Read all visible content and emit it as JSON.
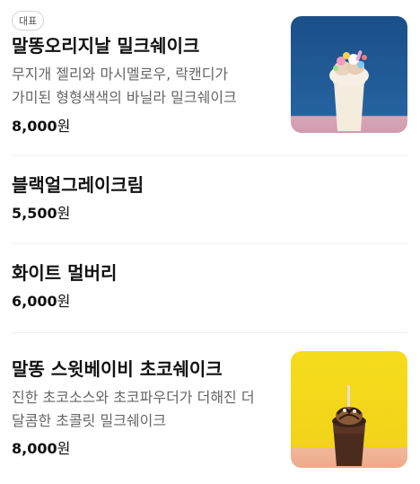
{
  "menu": {
    "items": [
      {
        "badge": "대표",
        "name": "말똥오리지날 밀크쉐이크",
        "description": "무지개 젤리와 마시멜로우, 락캔디가 가미된 형형색색의 바닐라 밀크쉐이크",
        "price": "8,000",
        "currency": "원",
        "image_icon": "milkshake-photo"
      },
      {
        "name": "블랙얼그레이크림",
        "price": "5,500",
        "currency": "원"
      },
      {
        "name": "화이트 멀버리",
        "price": "6,000",
        "currency": "원"
      },
      {
        "name": "말똥 스윗베이비 초코쉐이크",
        "description": "진한 초코소스와 초코파우더가 더해진 더 달콤한 초콜릿 밀크쉐이크",
        "price": "8,000",
        "currency": "원",
        "image_icon": "chocolate-shake-photo"
      }
    ]
  },
  "colors": {
    "photo1_bg_top": "#1f5a95",
    "photo1_bg_bottom": "#d7a9b8",
    "photo2_bg_top": "#f3d91d",
    "photo2_bg_bottom": "#f0b39a"
  }
}
